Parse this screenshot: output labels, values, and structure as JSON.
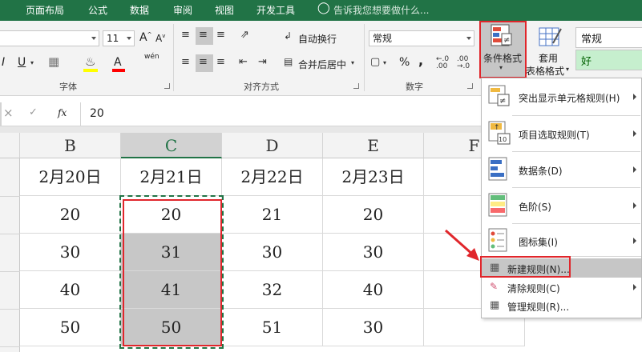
{
  "tabs": [
    "页面布局",
    "公式",
    "数据",
    "审阅",
    "视图",
    "开发工具"
  ],
  "tell_me": "告诉我您想要做什么...",
  "font": {
    "size": "11",
    "group_label": "字体",
    "grow_icon": "A",
    "shrink_icon": "A",
    "italic": "I",
    "underline": "U",
    "font_color_icon": "A",
    "phonetic_icon": "wén"
  },
  "alignment": {
    "wrap_text": "自动换行",
    "merge_center": "合并后居中",
    "group_label": "对齐方式"
  },
  "number": {
    "format": "常规",
    "group_label": "数字",
    "percent": "%",
    "comma": ","
  },
  "styles": {
    "conditional_format": "条件格式",
    "table_format_line1": "套用",
    "table_format_line2": "表格格式",
    "style_normal": "常规",
    "style_good": "好"
  },
  "formula_bar": {
    "value": "20",
    "cancel": "×",
    "enter": "✓",
    "fx": "fx"
  },
  "columns": [
    "B",
    "C",
    "D",
    "E",
    "F"
  ],
  "headers": [
    "2月20日",
    "2月21日",
    "2月22日",
    "2月23日"
  ],
  "rows": [
    [
      "20",
      "20",
      "21",
      "20"
    ],
    [
      "30",
      "31",
      "30",
      "30"
    ],
    [
      "40",
      "41",
      "32",
      "40"
    ],
    [
      "50",
      "50",
      "51",
      "30"
    ]
  ],
  "menu": {
    "items": [
      {
        "label": "突出显示单元格规则(H)",
        "icon": "highlight-cells-icon"
      },
      {
        "label": "项目选取规则(T)",
        "icon": "top-bottom-icon"
      },
      {
        "label": "数据条(D)",
        "icon": "data-bars-icon"
      },
      {
        "label": "色阶(S)",
        "icon": "color-scales-icon"
      },
      {
        "label": "图标集(I)",
        "icon": "icon-sets-icon"
      }
    ],
    "new_rule": "新建规则(N)...",
    "clear_rules": "清除规则(C)",
    "manage_rules": "管理规则(R)..."
  },
  "colors": {
    "excel_green": "#217346",
    "highlight_red": "#e0262b",
    "selection_gray": "#c7c7c7",
    "good_fill": "#c6efce",
    "good_text": "#006100"
  }
}
